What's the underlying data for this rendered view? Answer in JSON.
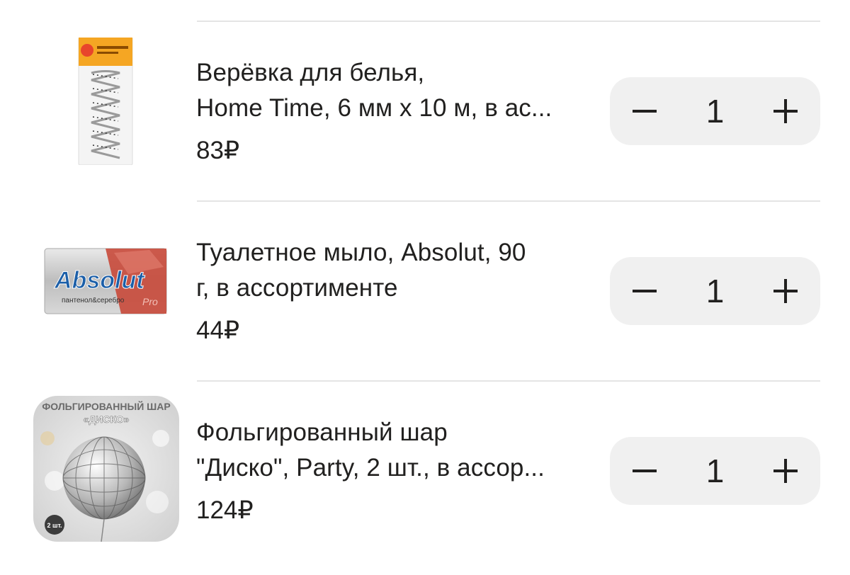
{
  "currency": "₽",
  "items": [
    {
      "title_line1": "Верёвка для белья,",
      "title_line2": "Home Time, 6 мм х 10 м, в ас...",
      "price": "83₽",
      "quantity": "1",
      "image_icon": "rope-package-icon"
    },
    {
      "title_line1": "Туалетное мыло, Absolut, 90",
      "title_line2": "г, в ассортименте",
      "price": "44₽",
      "quantity": "1",
      "image_icon": "soap-bar-icon",
      "image_text": "Absolut",
      "image_subtext": "пантенол&серебро",
      "image_pro": "Pro"
    },
    {
      "title_line1": "Фольгированный шар",
      "title_line2": "\"Диско\", Party, 2 шт., в ассор...",
      "price": "124₽",
      "quantity": "1",
      "image_icon": "disco-balloon-icon",
      "image_header": "ФОЛЬГИРОВАННЫЙ ШАР",
      "image_subheader": "«ДИСКО»",
      "image_badge": "2 шт."
    }
  ],
  "stepper": {
    "minus_icon": "minus-icon",
    "plus_icon": "plus-icon"
  },
  "colors": {
    "text": "#21201f",
    "stepper_bg": "#f0f0f0",
    "divider": "#e4e4e4"
  }
}
